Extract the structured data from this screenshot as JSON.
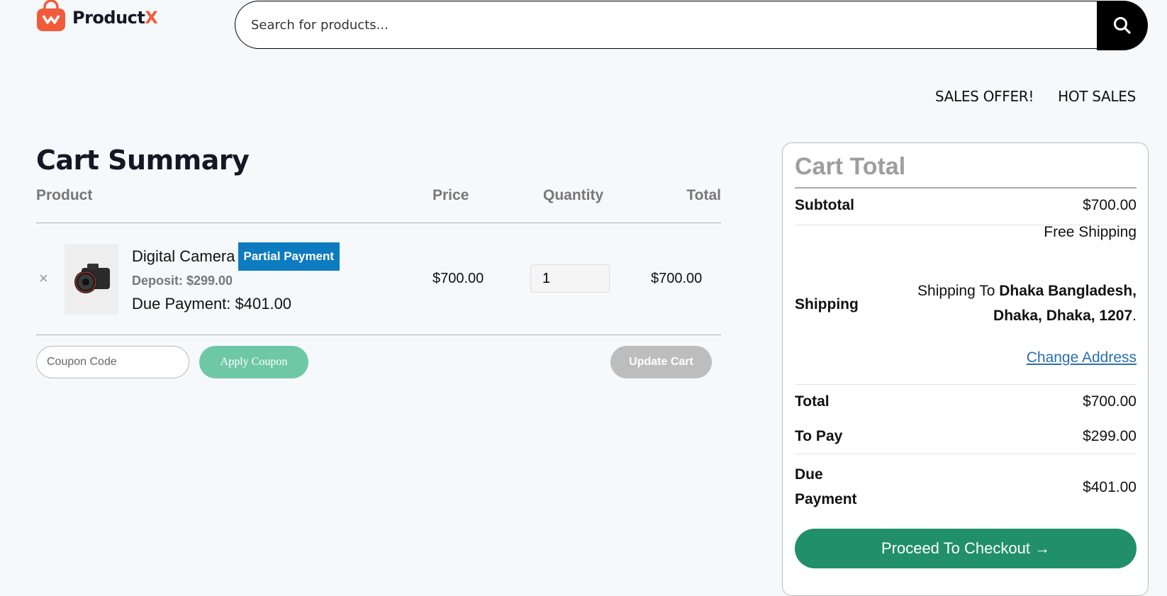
{
  "brand": {
    "name_main": "Product",
    "name_accent": "X",
    "accent_color": "#f25b3a"
  },
  "search": {
    "placeholder": "Search for products..."
  },
  "topnav": [
    {
      "label": "SALES OFFER!"
    },
    {
      "label": "HOT SALES"
    }
  ],
  "cart": {
    "title": "Cart Summary",
    "columns": {
      "product": "Product",
      "price": "Price",
      "quantity": "Quantity",
      "total": "Total"
    },
    "items": [
      {
        "name": "Digital Camera",
        "badge": "Partial Payment",
        "deposit": "Deposit: $299.00",
        "due_payment": "Due Payment: $401.00",
        "price": "$700.00",
        "quantity": "1",
        "total": "$700.00",
        "remove_icon": "×"
      }
    ],
    "coupon_placeholder": "Coupon Code",
    "apply_coupon": "Apply Coupon",
    "update_cart": "Update Cart"
  },
  "totals": {
    "title": "Cart Total",
    "subtotal_label": "Subtotal",
    "subtotal_value": "$700.00",
    "shipping_method": "Free Shipping",
    "shipping_label": "Shipping",
    "shipping_to_prefix": "Shipping To",
    "shipping_address_line1": "Dhaka Bangladesh,",
    "shipping_address_line2": "Dhaka, Dhaka, 1207",
    "change_address": "Change Address",
    "total_label": "Total",
    "total_value": "$700.00",
    "to_pay_label": "To Pay",
    "to_pay_value": "$299.00",
    "due_label_line1": "Due",
    "due_label_line2": "Payment",
    "due_value": "$401.00",
    "checkout": "Proceed To Checkout →"
  },
  "colors": {
    "checkout": "#208f6a",
    "apply": "#6fc8a5",
    "badge": "#0d7bbf",
    "link": "#2a6fb0"
  }
}
